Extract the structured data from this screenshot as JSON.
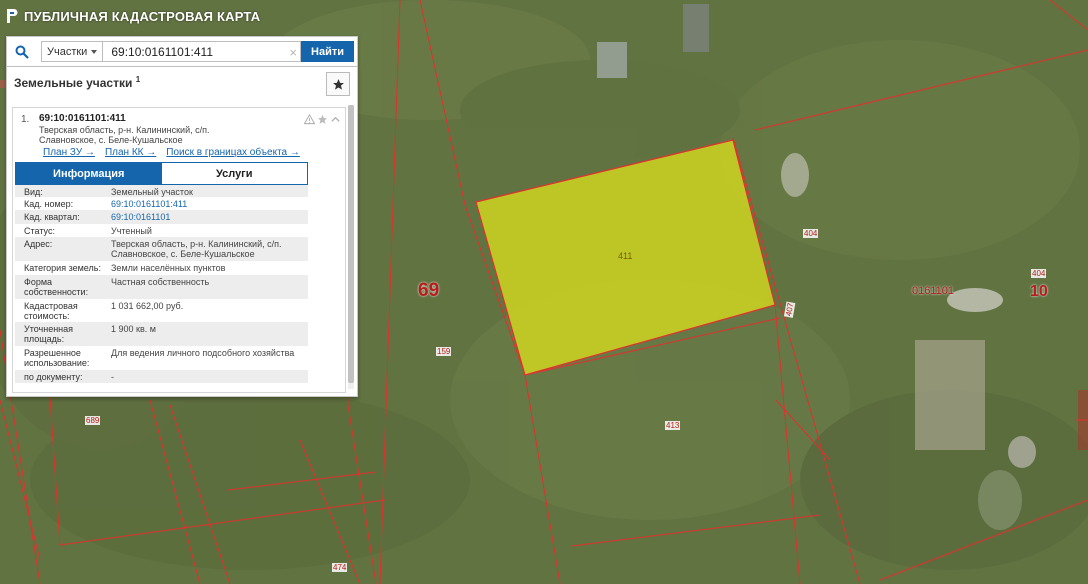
{
  "app": {
    "title": "ПУБЛИЧНАЯ КАДАСТРОВАЯ КАРТА"
  },
  "search": {
    "type_label": "Участки",
    "query": "69:10:0161101:411",
    "find_label": "Найти",
    "clear_glyph": "×"
  },
  "results": {
    "title": "Земельные участки",
    "count": "1",
    "item": {
      "index": "1.",
      "cad_number": "69:10:0161101:411",
      "address": "Тверская область, р-н. Калининский, с/п. Славновское, с. Беле-Кушальское",
      "links": [
        "План ЗУ →",
        "План КК →",
        "Поиск в границах объекта →"
      ],
      "tabs": [
        "Информация",
        "Услуги"
      ],
      "properties": [
        {
          "key": "Вид:",
          "value": "Земельный участок"
        },
        {
          "key": "Кад. номер:",
          "value": "69:10:0161101:411"
        },
        {
          "key": "Кад. квартал:",
          "value": "69:10:0161101"
        },
        {
          "key": "Статус:",
          "value": "Учтенный"
        },
        {
          "key": "Адрес:",
          "value": "Тверская область, р-н. Калининский, с/п. Славновское, с. Беле-Кушальское"
        },
        {
          "key": "Категория земель:",
          "value": "Земли населённых пунктов"
        },
        {
          "key": "Форма собственности:",
          "value": "Частная собственность"
        },
        {
          "key": "Кадастровая стоимость:",
          "value": "1 031 662,00 руб."
        },
        {
          "key": "Уточненная площадь:",
          "value": "1 900 кв. м"
        },
        {
          "key": "Разрешенное использование:",
          "value": "Для ведения личного подсобного хозяйства"
        },
        {
          "key": "по документу:",
          "value": "-"
        }
      ]
    }
  },
  "map": {
    "region_label": "69",
    "district_label": "10",
    "quarter_label": "0161101",
    "parcel_labels": {
      "selected": "411",
      "p404a": "404",
      "p404b": "404",
      "p407": "407",
      "p159": "159",
      "p413": "413",
      "p689": "689",
      "p474": "474",
      "p689v": "689"
    },
    "colors": {
      "boundary": "#e0312f",
      "selected_fill": "#d8de1e",
      "accent": "#1565ad"
    }
  }
}
